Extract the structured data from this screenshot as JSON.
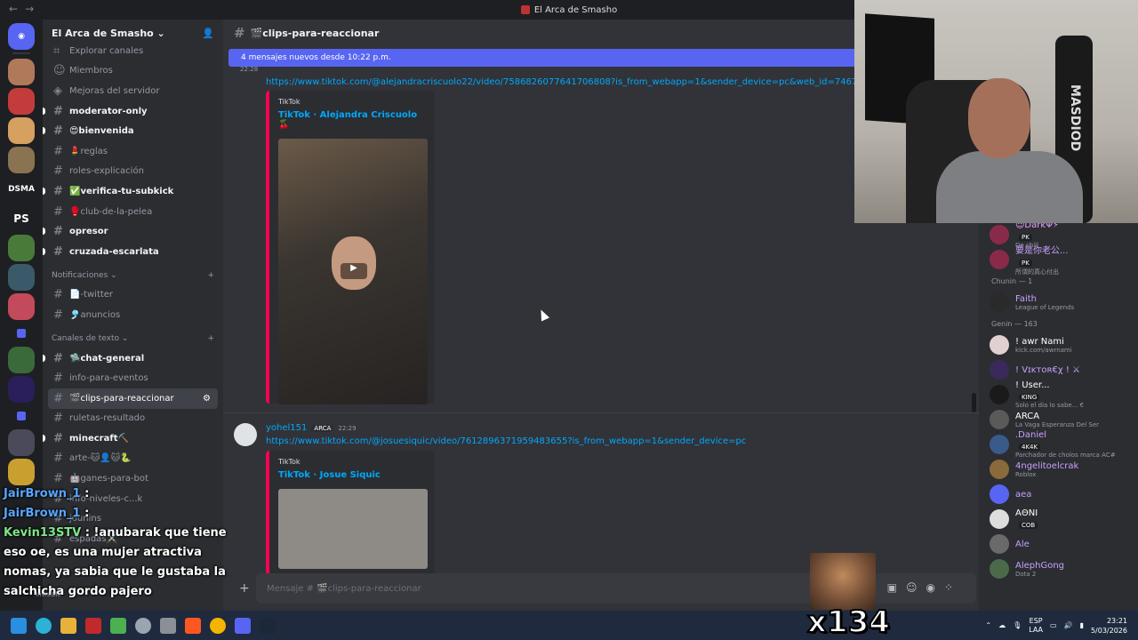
{
  "window": {
    "title": "El Arca de Smasho",
    "nav_back": "←",
    "nav_forward": "→"
  },
  "server": {
    "name": "El Arca de Smasho ⌄"
  },
  "sidebar": {
    "top_items": [
      "Explorar canales",
      "Miembros",
      "Mejoras del servidor"
    ],
    "channels_a": [
      {
        "label": "moderator-only",
        "unread": true
      },
      {
        "label": "😍bienvenida",
        "unread": true
      },
      {
        "label": "💄reglas",
        "unread": false
      },
      {
        "label": "roles-explicación",
        "unread": false
      },
      {
        "label": "✅verifica-tu-subkick",
        "unread": true
      },
      {
        "label": "🥊club-de-la-pelea",
        "unread": false
      },
      {
        "label": "opresor",
        "unread": true
      },
      {
        "label": "cruzada-escarlata",
        "unread": true
      }
    ],
    "cat_notif": "Notificaciones ⌄",
    "channels_b": [
      "📄-twitter",
      "🎐anuncios"
    ],
    "cat_text": "Canales de texto ⌄",
    "channels_c": [
      {
        "label": "🛸chat-general",
        "unread": true,
        "active": false
      },
      {
        "label": "info-para-eventos",
        "unread": false,
        "active": false
      },
      {
        "label": "🎬clips-para-reaccionar",
        "unread": false,
        "active": true
      },
      {
        "label": "ruletas-resultado",
        "unread": false,
        "active": false
      },
      {
        "label": "minecraft⛏️",
        "unread": true,
        "active": false
      },
      {
        "label": "arte-🐱👤🐱🐍",
        "unread": false,
        "active": false
      },
      {
        "label": "🤖ganes-para-bot",
        "unread": false,
        "active": false
      },
      {
        "label": "info-niveles-c...k",
        "unread": false,
        "active": false
      },
      {
        "label": "jounins",
        "unread": false,
        "active": false
      },
      {
        "label": "espadas⚔️",
        "unread": false,
        "active": false
      }
    ],
    "guild_labels": [
      "DSMA",
      "PS"
    ]
  },
  "channel": {
    "name": "🎬clips-para-reaccionar"
  },
  "new_messages_bar": "4 mensajes nuevos desde 10:22 p.m.",
  "messages": [
    {
      "time": "22:28",
      "link": "https://www.tiktok.com/@alejandracriscuolo22/video/7586826077641706808?is_from_webapp=1&sender_device=pc&web_id=746739428956012",
      "embed_provider": "TikTok",
      "embed_title": "TikTok · Alejandra Criscuolo 🍒"
    },
    {
      "author": "yohel151",
      "badge": "ARCA",
      "time": "22:29",
      "link": "https://www.tiktok.com/@josuesiquic/video/7612896371959483655?is_from_webapp=1&sender_device=pc",
      "embed_provider": "TikTok",
      "embed_title": "TikTok · Josue Siquic"
    }
  ],
  "composer": {
    "placeholder": "Mensaje # 🎬clips-para-reaccionar"
  },
  "members": {
    "rows_top": [
      {
        "name": "😈DarkΨ⚡",
        "tag": "PK",
        "sub": "De chill",
        "color": "#eaa0ff"
      },
      {
        "name": "要是你老公...",
        "tag": "PK",
        "sub": "所谓的真心付出",
        "color": "#c9a0ff"
      }
    ],
    "group_chunin": "Chunin — 1",
    "chunin": [
      {
        "name": "Faith",
        "sub": "League of Legends",
        "color": "#c9a0ff"
      }
    ],
    "group_genin": "Genin — 163",
    "genin": [
      {
        "name": "! awr Nami",
        "sub": "kick.com/awrnami",
        "tag": "",
        "color": "#ffffff"
      },
      {
        "name": "! Vɪᴋᴛᴏʀ€χ ! ⚔",
        "sub": "",
        "tag": "",
        "color": "#c9a0ff"
      },
      {
        "name": "! User...",
        "sub": "Solo el dia lo sabe... €",
        "tag": "KING",
        "color": "#ffffff"
      },
      {
        "name": "ARCA",
        "sub": "La Vaga Esperanza Del Ser",
        "tag": "",
        "color": "#ffffff"
      },
      {
        "name": ".Daniel",
        "sub": "Parchador de cholos marca AC#",
        "tag": "4K4K",
        "color": "#c9a0ff"
      },
      {
        "name": "4ngelitoelcrak",
        "sub": "Roblox",
        "tag": "",
        "color": "#c9a0ff"
      },
      {
        "name": "aea",
        "sub": "",
        "tag": "",
        "color": "#c9a0ff"
      },
      {
        "name": "AΘNI",
        "sub": "",
        "tag": "COB",
        "color": "#ffffff"
      },
      {
        "name": "Ale",
        "sub": "",
        "tag": "",
        "color": "#c9a0ff"
      },
      {
        "name": "AlephGong",
        "sub": "Dota 2",
        "tag": "",
        "color": "#c9a0ff"
      }
    ]
  },
  "webcam": {
    "bag_text": "MASDIOD"
  },
  "overlay_chat": [
    {
      "user": "JairBrown_1",
      "text": ":"
    },
    {
      "user": "JairBrown_1",
      "text": ":"
    },
    {
      "user": "Kevin13STV",
      "text": ": !anubarak que tiene eso oe, es una mujer atractiva nomas, ya sabia que le gustaba la salchicha gordo pajero"
    }
  ],
  "emote_counter": "x134",
  "user_status": "Invisible",
  "taskbar": {
    "lang": "ESP",
    "region": "LAA",
    "time": "23:21",
    "date": "5/03/2026"
  }
}
